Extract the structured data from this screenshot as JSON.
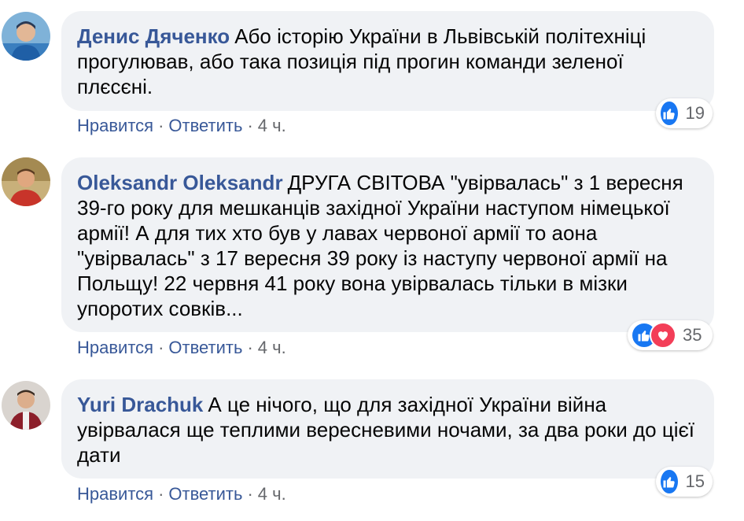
{
  "comments": [
    {
      "author": "Денис Дяченко",
      "text": "Або історію України в Львівській політехніці прогулював, або така позиція під прогин команди зеленої плєсєні.",
      "reactions": {
        "count": "19",
        "types": [
          "like"
        ]
      },
      "actions": {
        "like": "Нравится",
        "reply": "Ответить",
        "time": "4 ч."
      }
    },
    {
      "author": "Oleksandr Oleksandr",
      "text": "ДРУГА СВІТОВА \"увірвалась\" з 1 вересня 39-го року для мешканців західної України наступом німецької армії! А для тих хто був у лавах червоної армії то аона \"увірвалась\" з 17 вересня 39 року із наступу червоної армії на Польщу! 22 червня 41 року вона увірвалась тільки в мізки упоротих совків...",
      "reactions": {
        "count": "35",
        "types": [
          "like",
          "love"
        ]
      },
      "actions": {
        "like": "Нравится",
        "reply": "Ответить",
        "time": "4 ч."
      }
    },
    {
      "author": "Yuri Drachuk",
      "text": "А це нічого, що для західної України війна увірвалася ще теплими вересневими ночами, за два роки до цієї дати",
      "reactions": {
        "count": "15",
        "types": [
          "like"
        ]
      },
      "actions": {
        "like": "Нравится",
        "reply": "Ответить",
        "time": "4 ч."
      }
    }
  ],
  "separator": "·",
  "colors": {
    "author": "#385898",
    "bubble": "#f0f2f5",
    "like": "#1877f2",
    "love": "#f33e58"
  }
}
